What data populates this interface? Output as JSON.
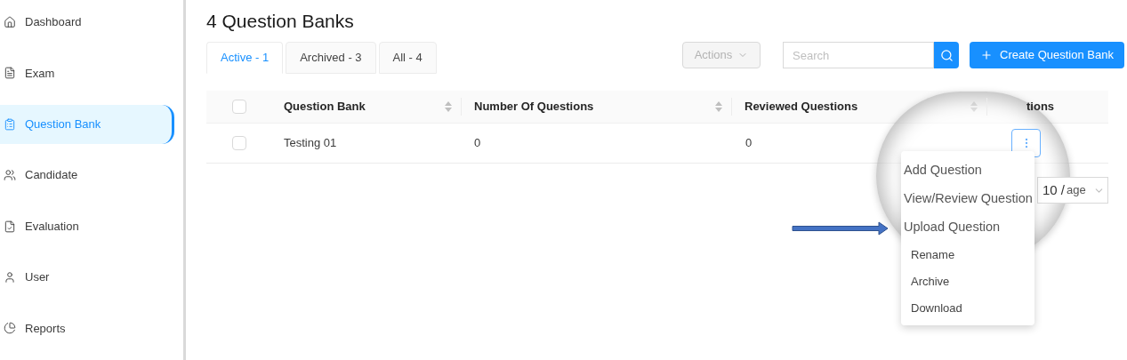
{
  "sidebar": {
    "items": [
      {
        "label": "Dashboard",
        "selected": false
      },
      {
        "label": "Exam",
        "selected": false
      },
      {
        "label": "Question Bank",
        "selected": true
      },
      {
        "label": "Candidate",
        "selected": false
      },
      {
        "label": "Evaluation",
        "selected": false
      },
      {
        "label": "User",
        "selected": false
      },
      {
        "label": "Reports",
        "selected": false
      }
    ]
  },
  "title": "4 Question Banks",
  "tabs": [
    {
      "label": "Active - 1",
      "selected": true
    },
    {
      "label": "Archived - 3",
      "selected": false
    },
    {
      "label": "All - 4",
      "selected": false
    }
  ],
  "actions_dropdown": {
    "label": "Actions",
    "disabled": true
  },
  "search": {
    "placeholder": "Search"
  },
  "create_button": {
    "label": "Create Question Bank"
  },
  "table": {
    "columns": [
      {
        "label": "Question Bank",
        "sortable": true
      },
      {
        "label": "Number Of Questions",
        "sortable": true
      },
      {
        "label": "Reviewed Questions",
        "sortable": true
      },
      {
        "label": "tions",
        "sortable": false
      }
    ],
    "rows": [
      {
        "checked": false,
        "cells": [
          "Testing 01",
          "0",
          "0"
        ]
      }
    ]
  },
  "header_checkbox": {
    "checked": false
  },
  "pagination": {
    "page_size": "10 /",
    "page_size_rest": "age"
  },
  "row_menu": {
    "items": [
      {
        "label": "Add Question",
        "magnified": true
      },
      {
        "label": "View/Review Question",
        "magnified": true
      },
      {
        "label": "Upload Question",
        "magnified": true
      },
      {
        "label": "Rename",
        "magnified": false
      },
      {
        "label": "Archive",
        "magnified": false
      },
      {
        "label": "Download",
        "magnified": false
      }
    ]
  }
}
